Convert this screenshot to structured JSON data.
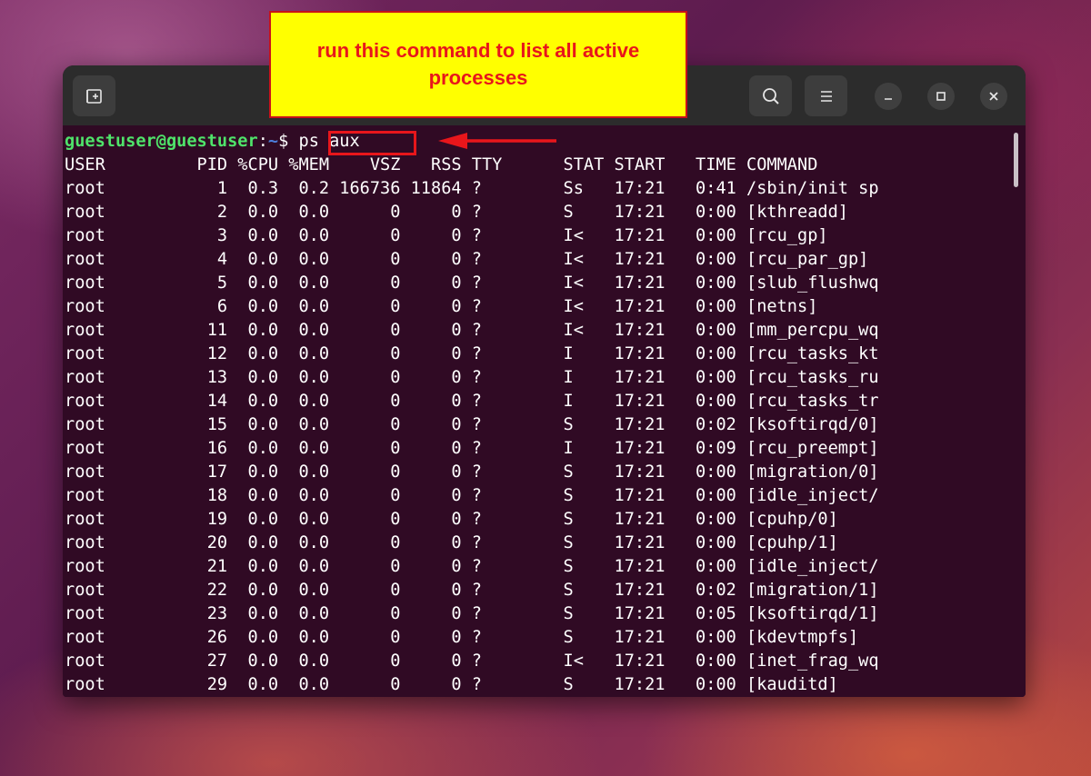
{
  "callout": {
    "text": "run this command to list all active processes",
    "color": "#e8161b",
    "background": "#ffff00"
  },
  "titlebar": {
    "new_tab_icon": "new-tab-icon",
    "search_icon": "search-icon",
    "menu_icon": "hamburger-menu-icon",
    "minimize_icon": "minimize-icon",
    "maximize_icon": "maximize-icon",
    "close_icon": "close-icon"
  },
  "prompt": {
    "user": "guestuser@guestuser",
    "sep": ":",
    "path": "~",
    "symbol": "$ ",
    "command": "ps aux"
  },
  "colors": {
    "terminal_bg": "#300a24",
    "prompt_user": "#4fe36a",
    "prompt_path": "#4c7edb",
    "text": "#ffffff"
  },
  "output": [
    "USER         PID %CPU %MEM    VSZ   RSS TTY      STAT START   TIME COMMAND",
    "root           1  0.3  0.2 166736 11864 ?        Ss   17:21   0:41 /sbin/init sp",
    "root           2  0.0  0.0      0     0 ?        S    17:21   0:00 [kthreadd]",
    "root           3  0.0  0.0      0     0 ?        I<   17:21   0:00 [rcu_gp]",
    "root           4  0.0  0.0      0     0 ?        I<   17:21   0:00 [rcu_par_gp]",
    "root           5  0.0  0.0      0     0 ?        I<   17:21   0:00 [slub_flushwq",
    "root           6  0.0  0.0      0     0 ?        I<   17:21   0:00 [netns]",
    "root          11  0.0  0.0      0     0 ?        I<   17:21   0:00 [mm_percpu_wq",
    "root          12  0.0  0.0      0     0 ?        I    17:21   0:00 [rcu_tasks_kt",
    "root          13  0.0  0.0      0     0 ?        I    17:21   0:00 [rcu_tasks_ru",
    "root          14  0.0  0.0      0     0 ?        I    17:21   0:00 [rcu_tasks_tr",
    "root          15  0.0  0.0      0     0 ?        S    17:21   0:02 [ksoftirqd/0]",
    "root          16  0.0  0.0      0     0 ?        I    17:21   0:09 [rcu_preempt]",
    "root          17  0.0  0.0      0     0 ?        S    17:21   0:00 [migration/0]",
    "root          18  0.0  0.0      0     0 ?        S    17:21   0:00 [idle_inject/",
    "root          19  0.0  0.0      0     0 ?        S    17:21   0:00 [cpuhp/0]",
    "root          20  0.0  0.0      0     0 ?        S    17:21   0:00 [cpuhp/1]",
    "root          21  0.0  0.0      0     0 ?        S    17:21   0:00 [idle_inject/",
    "root          22  0.0  0.0      0     0 ?        S    17:21   0:02 [migration/1]",
    "root          23  0.0  0.0      0     0 ?        S    17:21   0:05 [ksoftirqd/1]",
    "root          26  0.0  0.0      0     0 ?        S    17:21   0:00 [kdevtmpfs]",
    "root          27  0.0  0.0      0     0 ?        I<   17:21   0:00 [inet_frag_wq",
    "root          29  0.0  0.0      0     0 ?        S    17:21   0:00 [kauditd]"
  ]
}
